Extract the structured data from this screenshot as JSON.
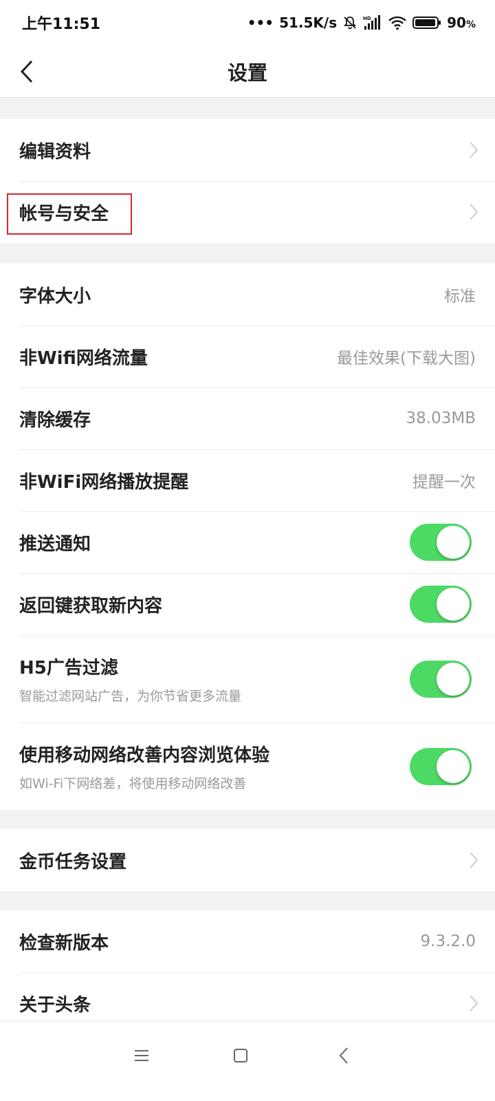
{
  "status_bar": {
    "time": "上午11:51",
    "network_speed": "51.5K/s",
    "battery": "90",
    "battery_unit": "%"
  },
  "header": {
    "title": "设置",
    "back_icon": "chevron-left-icon"
  },
  "group1": [
    {
      "label": "编辑资料"
    },
    {
      "label": "帐号与安全"
    }
  ],
  "group2": {
    "font_size": {
      "label": "字体大小",
      "value": "标准"
    },
    "non_wifi_traffic": {
      "label": "非Wifi网络流量",
      "value": "最佳效果(下载大图)"
    },
    "clear_cache": {
      "label": "清除缓存",
      "value": "38.03MB"
    },
    "non_wifi_play_alert": {
      "label": "非WiFi网络播放提醒",
      "value": "提醒一次"
    },
    "push_notify": {
      "label": "推送通知",
      "on": true
    },
    "back_refresh": {
      "label": "返回键获取新内容",
      "on": true
    },
    "h5_ad_filter": {
      "label": "H5广告过滤",
      "sub": "智能过滤网站广告，为你节省更多流量",
      "on": true
    },
    "mobile_boost": {
      "label": "使用移动网络改善内容浏览体验",
      "sub": "如Wi-Fi下网络差，将使用移动网络改善",
      "on": true
    }
  },
  "group3": {
    "coin_task": {
      "label": "金币任务设置"
    }
  },
  "group4": {
    "check_version": {
      "label": "检查新版本",
      "value": "9.3.2.0"
    },
    "about": {
      "label": "关于头条"
    }
  },
  "colors": {
    "toggle_on": "#4cd964",
    "highlight": "#d9262d"
  }
}
